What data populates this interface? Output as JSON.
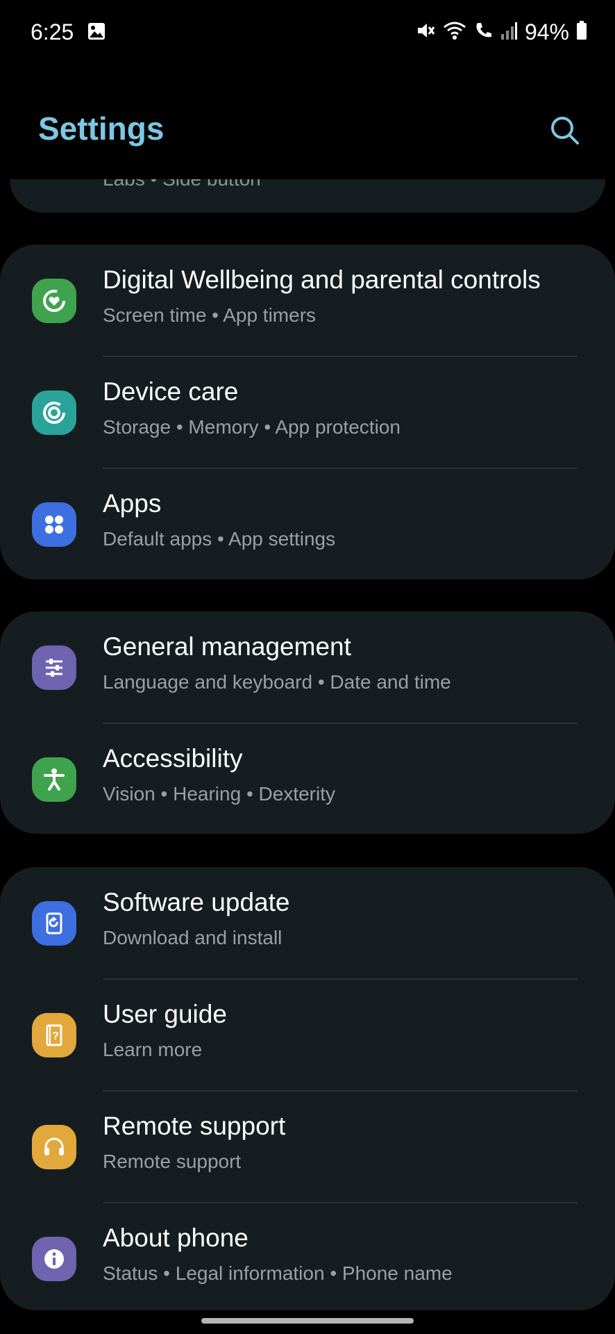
{
  "status_bar": {
    "time": "6:25",
    "battery": "94%",
    "icons": [
      "image-icon",
      "mute-icon",
      "wifi-icon",
      "wifi-calling-icon",
      "signal-icon",
      "battery-icon"
    ]
  },
  "header": {
    "title": "Settings",
    "search_icon": "search-icon"
  },
  "partial_item": {
    "subtitle": "Labs  •  Side button"
  },
  "groups": [
    {
      "items": [
        {
          "title": "Digital Wellbeing and parental controls",
          "subtitle": "Screen time  •  App timers",
          "icon": "digital-wellbeing-icon",
          "color": "#3fa34d"
        },
        {
          "title": "Device care",
          "subtitle": "Storage  •  Memory  •  App protection",
          "icon": "device-care-icon",
          "color": "#2aa39a"
        },
        {
          "title": "Apps",
          "subtitle": "Default apps  •  App settings",
          "icon": "apps-icon",
          "color": "#3d6fe0"
        }
      ]
    },
    {
      "items": [
        {
          "title": "General management",
          "subtitle": "Language and keyboard  •  Date and time",
          "icon": "general-management-icon",
          "color": "#6e64b0"
        },
        {
          "title": "Accessibility",
          "subtitle": "Vision  •  Hearing  •  Dexterity",
          "icon": "accessibility-icon",
          "color": "#3fa34d"
        }
      ]
    },
    {
      "items": [
        {
          "title": "Software update",
          "subtitle": "Download and install",
          "icon": "software-update-icon",
          "color": "#3d6fe0"
        },
        {
          "title": "User guide",
          "subtitle": "Learn more",
          "icon": "user-guide-icon",
          "color": "#e3a83c"
        },
        {
          "title": "Remote support",
          "subtitle": "Remote support",
          "icon": "remote-support-icon",
          "color": "#e3a83c"
        },
        {
          "title": "About phone",
          "subtitle": "Status  •  Legal information  •  Phone name",
          "icon": "info-icon",
          "color": "#6e64b0"
        }
      ]
    }
  ]
}
